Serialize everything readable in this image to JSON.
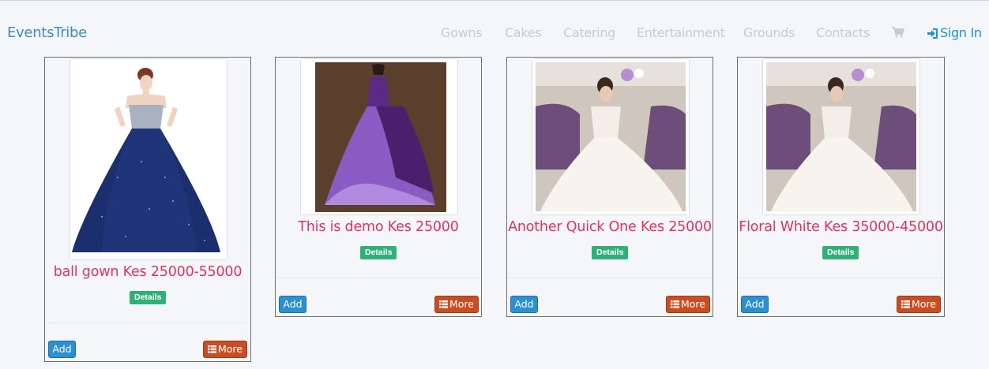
{
  "navbar": {
    "brand": "EventsTribe",
    "links": [
      "Gowns",
      "Cakes",
      "Catering",
      "Entertainment",
      "Grounds",
      "Contacts"
    ],
    "cart_icon": "shopping-cart-icon",
    "signin_icon": "sign-in-icon",
    "signin_label": "Sign In"
  },
  "products": [
    {
      "title": "ball gown Kes 25000-55000",
      "details_label": "Details",
      "add_label": "Add",
      "more_label": "More",
      "image": "navy-ball-gown"
    },
    {
      "title": "This is demo Kes 25000",
      "details_label": "Details",
      "add_label": "Add",
      "more_label": "More",
      "image": "purple-gown-back"
    },
    {
      "title": "Another Quick One Kes 25000",
      "details_label": "Details",
      "add_label": "Add",
      "more_label": "More",
      "image": "white-bridal-gown"
    },
    {
      "title": "Floral White Kes 35000-45000",
      "details_label": "Details",
      "add_label": "Add",
      "more_label": "More",
      "image": "white-bridal-gown"
    }
  ],
  "colors": {
    "brand": "#3c8dbc",
    "title": "#e0345c",
    "details": "#2fb077",
    "add": "#2c8fd0",
    "more": "#c94d22"
  }
}
